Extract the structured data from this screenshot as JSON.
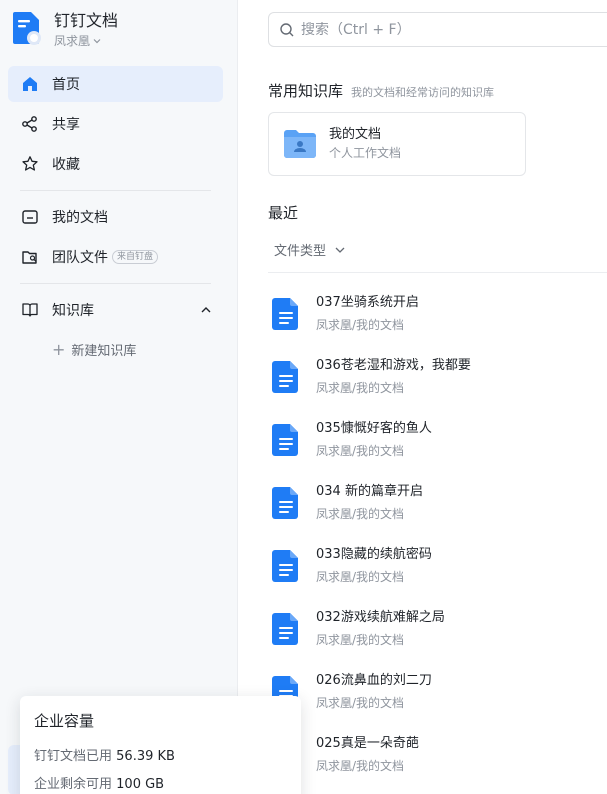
{
  "brand": {
    "title": "钉钉文档",
    "user": "凤求凰"
  },
  "nav": {
    "home": "首页",
    "share": "共享",
    "favorites": "收藏",
    "my_docs": "我的文档",
    "team_files": "团队文件",
    "team_badge": "来自钉盘",
    "knowledge": "知识库",
    "new_kb": "新建知识库"
  },
  "search": {
    "placeholder": "搜索（Ctrl + F）"
  },
  "common_kb": {
    "title": "常用知识库",
    "subtitle": "我的文档和经常访问的知识库",
    "card_title": "我的文档",
    "card_sub": "个人工作文档"
  },
  "recent": {
    "title": "最近",
    "filter": "文件类型",
    "files": [
      {
        "name": "037坐骑系统开启",
        "path": "凤求凰/我的文档"
      },
      {
        "name": "036苍老湿和游戏，我都要",
        "path": "凤求凰/我的文档"
      },
      {
        "name": "035慷慨好客的鱼人",
        "path": "凤求凰/我的文档"
      },
      {
        "name": "034 新的篇章开启",
        "path": "凤求凰/我的文档"
      },
      {
        "name": "033隐藏的续航密码",
        "path": "凤求凰/我的文档"
      },
      {
        "name": "032游戏续航难解之局",
        "path": "凤求凰/我的文档"
      },
      {
        "name": "026流鼻血的刘二刀",
        "path": "凤求凰/我的文档"
      },
      {
        "name": "025真是一朵奇葩",
        "path": "凤求凰/我的文档"
      }
    ]
  },
  "storage": {
    "title": "企业容量",
    "used_label": "钉钉文档已用",
    "used_value": "56.39 KB",
    "remain_label": "企业剩余可用",
    "remain_value": "100 GB"
  },
  "colors": {
    "accent": "#1f7cf5",
    "active_bg": "#e6eefc"
  }
}
